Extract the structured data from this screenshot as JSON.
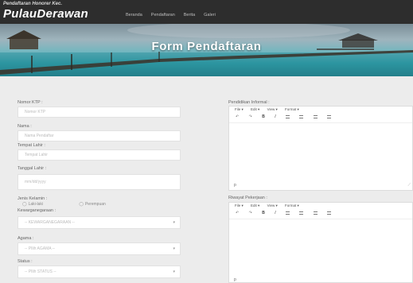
{
  "brand": {
    "subtitle": "Pendaftaran Honorer Kec.",
    "title": "PulauDerawan"
  },
  "nav": [
    "Beranda",
    "Pendaftaran",
    "Berita",
    "Galeri"
  ],
  "hero": {
    "title": "Form Pendaftaran"
  },
  "form": {
    "ktp": {
      "label": "Nomor KTP :",
      "placeholder": "Nomor KTP"
    },
    "nama": {
      "label": "Nama :",
      "placeholder": "Nama Pendaftar"
    },
    "tempat": {
      "label": "Tempat Lahir :",
      "placeholder": "Tempat Lahir"
    },
    "tanggal": {
      "label": "Tanggal Lahir :",
      "placeholder": "mm/dd/yyyy"
    },
    "gender": {
      "label": "Jenis Kelamin :",
      "options": [
        "Laki-laki",
        "Perempuan"
      ]
    },
    "kewarganegaraan": {
      "label": "Kewarganegaraan :",
      "value": "-- KEWARGANEGARAAN --"
    },
    "agama": {
      "label": "Agama :",
      "value": "-- PIlih AGAMA --"
    },
    "status": {
      "label": "Status :",
      "value": "-- PIlih STATUS --"
    },
    "informal": {
      "label": "Pendidikan Informal :",
      "status_text": "p"
    },
    "pekerjaan": {
      "label": "Riwayat Pekerjaan :",
      "status_text": "p"
    }
  },
  "editor_menu": [
    "File ▾",
    "Edit ▾",
    "View ▾",
    "Format ▾"
  ],
  "editor_toolbar": {
    "undo": "↶",
    "redo": "↷",
    "bold": "B",
    "italic": "I"
  },
  "icons": {
    "select_arrow": "▾",
    "radio": "◯",
    "resize": "⟋"
  }
}
